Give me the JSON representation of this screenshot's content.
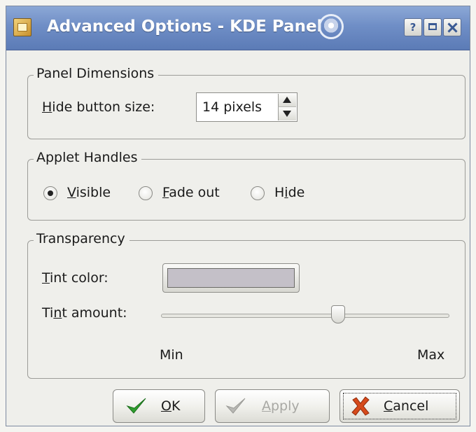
{
  "window": {
    "title": "Advanced Options - KDE Panel",
    "buttons": {
      "help": "?"
    }
  },
  "panel_dimensions": {
    "title": "Panel Dimensions",
    "hide_button_size": {
      "label_mnemonic": "H",
      "label_rest": "ide button size:",
      "value": "14 pixels"
    }
  },
  "applet_handles": {
    "title": "Applet Handles",
    "selected": "Visible",
    "options": [
      {
        "mnemonic": "V",
        "rest": "isible",
        "pre": ""
      },
      {
        "mnemonic": "F",
        "rest": "ade out",
        "pre": ""
      },
      {
        "mnemonic": "i",
        "rest": "de",
        "pre": "H"
      }
    ]
  },
  "transparency": {
    "title": "Transparency",
    "tint_color": {
      "label_mnemonic": "T",
      "label_rest": "int color:",
      "value_hex": "#c4c0c8"
    },
    "tint_amount": {
      "label_pre": "Ti",
      "label_mnemonic": "n",
      "label_rest": "t amount:",
      "value_fraction": 0.62,
      "min_label": "Min",
      "max_label": "Max"
    }
  },
  "buttons": {
    "ok": {
      "mnemonic": "O",
      "rest": "K"
    },
    "apply": {
      "mnemonic": "A",
      "rest": "pply",
      "enabled": false
    },
    "cancel": {
      "mnemonic": "C",
      "rest": "ancel"
    }
  },
  "colors": {
    "title_bar": "#6f8ec6",
    "ok_check": "#2e9e2e",
    "cancel_x": "#d64a1c"
  }
}
